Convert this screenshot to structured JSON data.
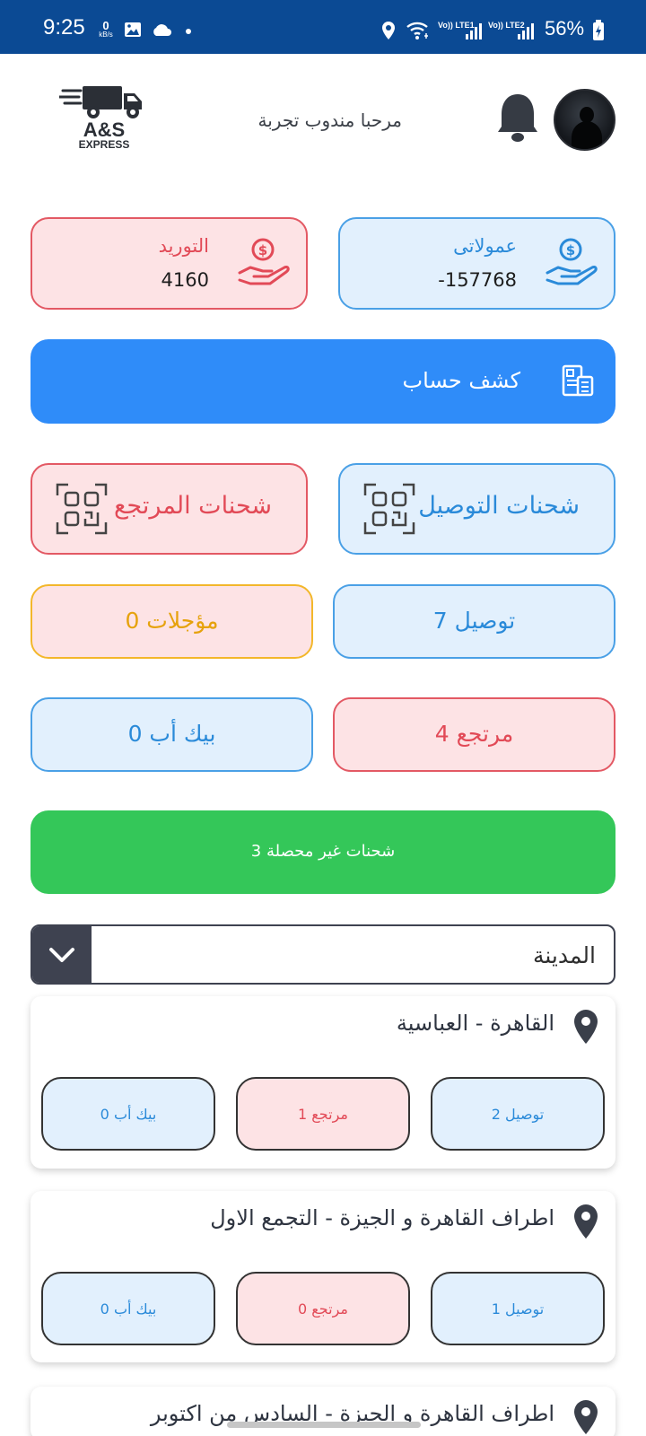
{
  "status_bar": {
    "time": "9:25",
    "net_speed_value": "0",
    "net_speed_unit": "kB/s",
    "sim1": "Vo)) LTE1",
    "sim2": "Vo)) LTE2",
    "battery": "56%"
  },
  "header": {
    "logo_text": "A&S",
    "logo_sub": "EXPRESS",
    "greeting": "مرحبا مندوب تجربة"
  },
  "stats": {
    "commissions_label": "عمولاتى",
    "commissions_value": "-157768",
    "supply_label": "التوريد",
    "supply_value": "4160"
  },
  "statement_label": "كشف حساب",
  "shipments": {
    "delivery_label": "شحنات التوصيل",
    "returns_label": "شحنات المرتجع"
  },
  "counts": {
    "delivery": "توصيل 7",
    "postponed": "مؤجلات 0",
    "returns": "مرتجع 4",
    "pickup": "بيك أب 0"
  },
  "uncollected_label": "شحنات غير محصلة 3",
  "city_select_label": "المدينة",
  "areas": [
    {
      "title": "القاهرة - العباسية",
      "delivery": "توصيل 2",
      "returns": "مرتجع 1",
      "pickup": "بيك أب 0"
    },
    {
      "title": "اطراف القاهرة و الجيزة - التجمع الاول",
      "delivery": "توصيل 1",
      "returns": "مرتجع 0",
      "pickup": "بيك أب 0"
    },
    {
      "title": "اطراف القاهرة و الجيزة - السادس من اكتوبر"
    }
  ],
  "colors": {
    "blue_text": "#2a8ad9",
    "pink_text": "#e24a57",
    "yellow_text": "#e6a20c",
    "statement_bg": "#2f8cf9",
    "green_bg": "#34c759",
    "status_bar_bg": "#0b4a94"
  }
}
